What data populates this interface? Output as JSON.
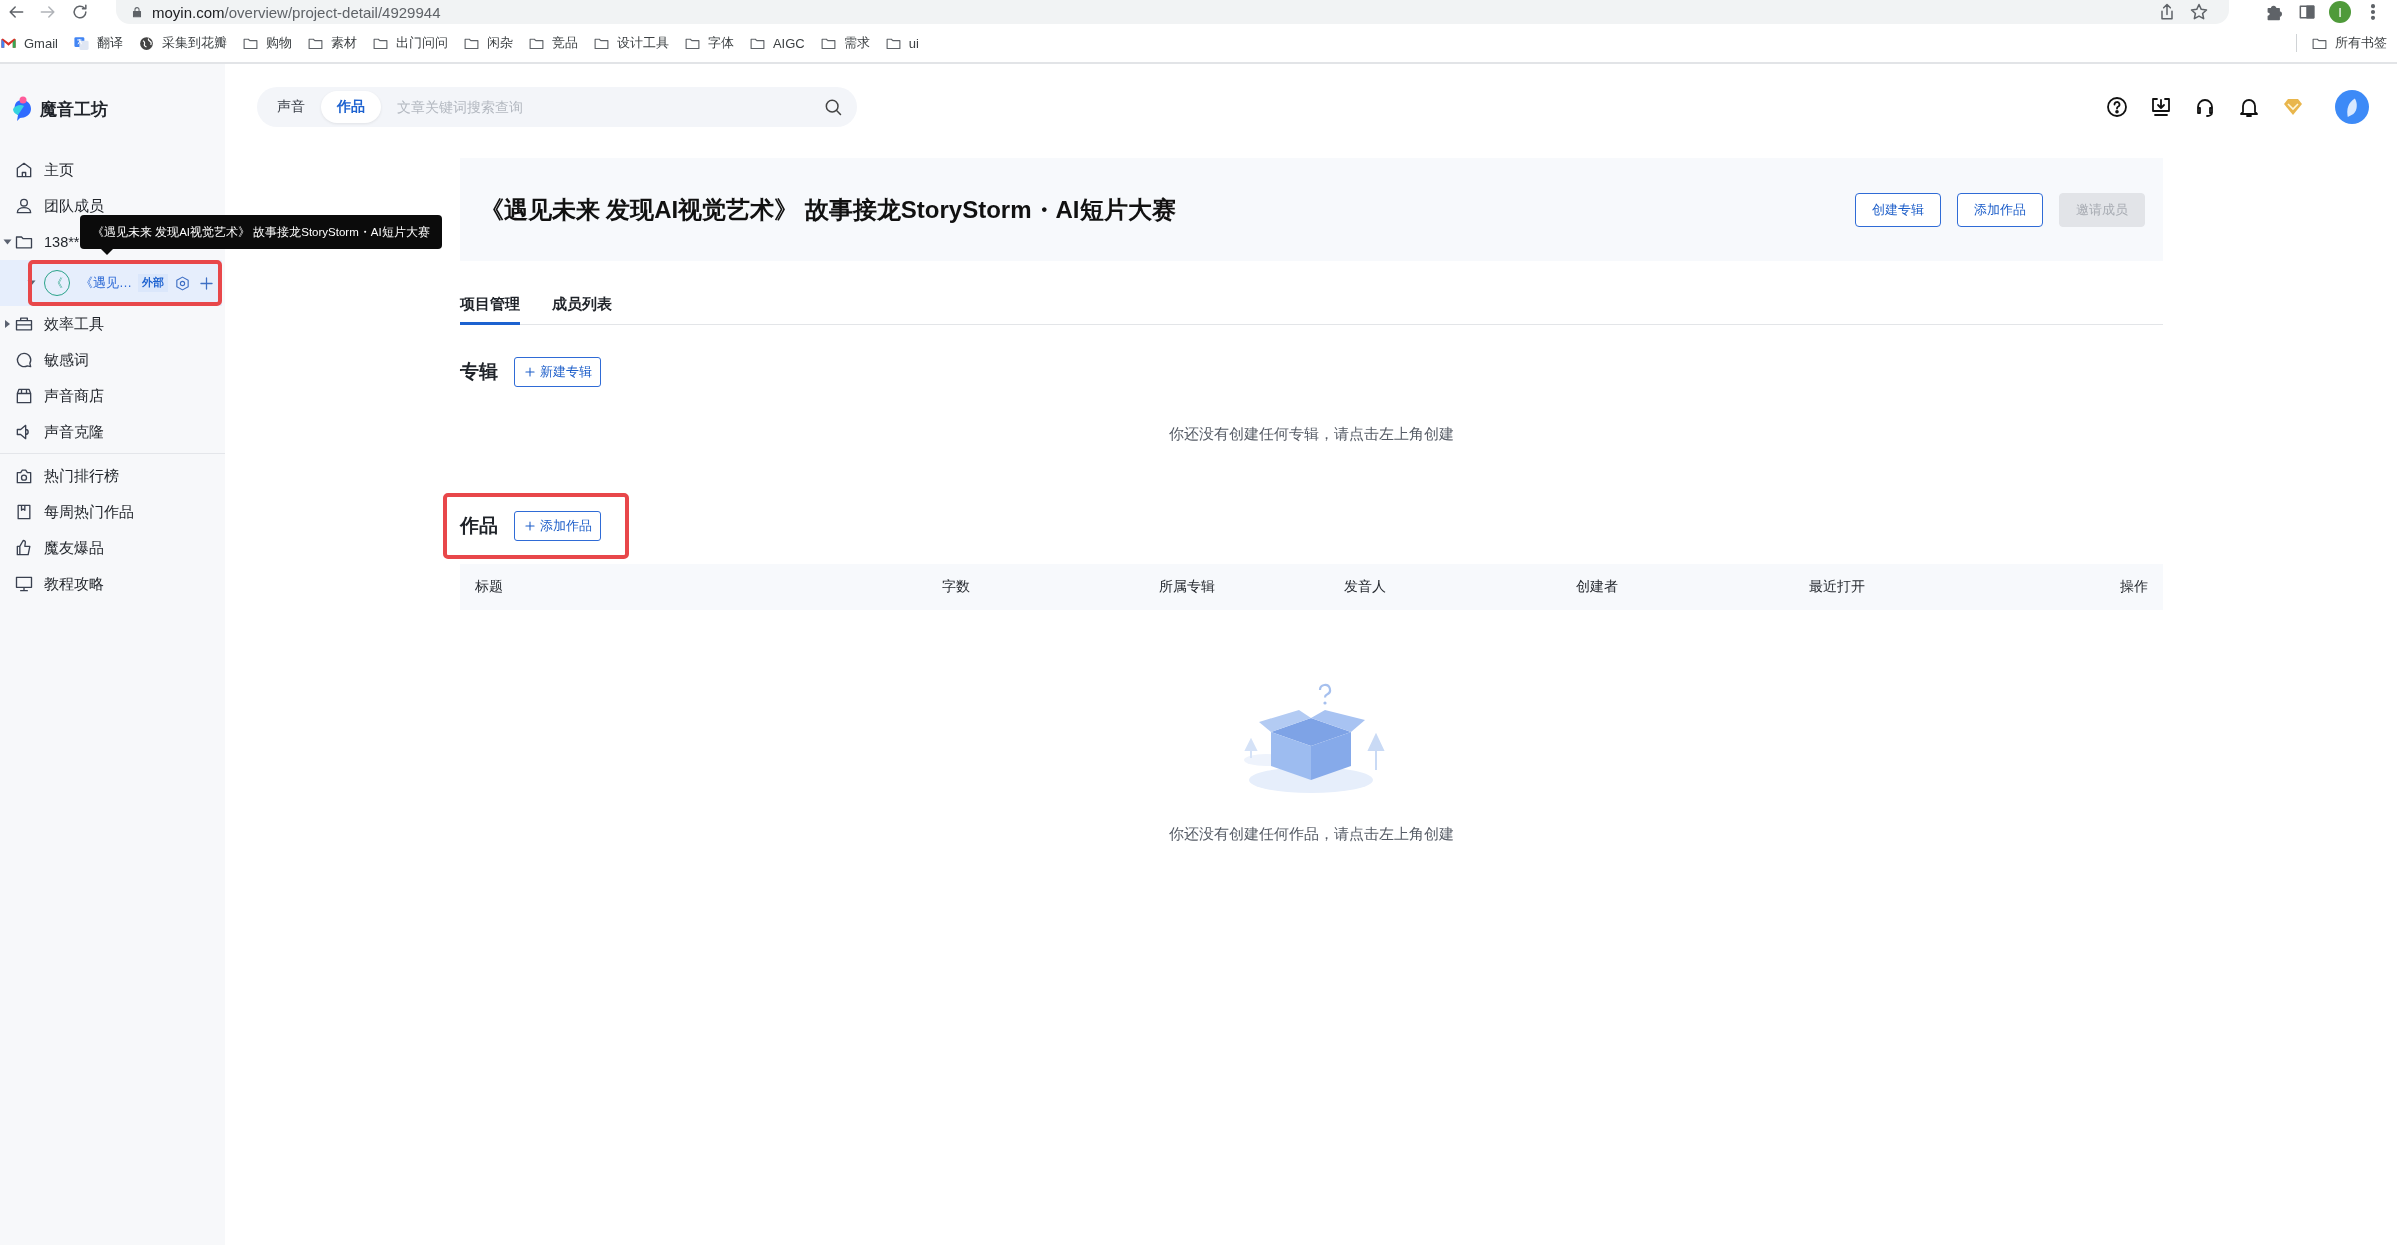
{
  "browser": {
    "url_host": "moyin.com",
    "url_path": "/overview/project-detail/4929944",
    "profile_initial": "I",
    "bookmarks": [
      {
        "label": "Gmail",
        "kind": "gmail"
      },
      {
        "label": "翻译",
        "kind": "translate"
      },
      {
        "label": "采集到花瓣",
        "kind": "globe"
      },
      {
        "label": "购物",
        "kind": "folder"
      },
      {
        "label": "素材",
        "kind": "folder"
      },
      {
        "label": "出门问问",
        "kind": "folder"
      },
      {
        "label": "闲杂",
        "kind": "folder"
      },
      {
        "label": "竞品",
        "kind": "folder"
      },
      {
        "label": "设计工具",
        "kind": "folder"
      },
      {
        "label": "字体",
        "kind": "folder"
      },
      {
        "label": "AIGC",
        "kind": "folder"
      },
      {
        "label": "需求",
        "kind": "folder"
      },
      {
        "label": "ui",
        "kind": "folder"
      }
    ],
    "all_bookmarks": "所有书签"
  },
  "app": {
    "name": "魔音工坊"
  },
  "sidebar": {
    "groups": [
      [
        {
          "label": "主页",
          "kind": "link"
        },
        {
          "label": "团队成员",
          "kind": "link"
        },
        {
          "label": "138**",
          "kind": "group",
          "expanded": true,
          "tooltip": "《遇见未来 发现AI视觉艺术》 故事接龙StoryStorm・AI短片大赛",
          "children": [
            {
              "label": "《遇见…",
              "avatar_text": "《",
              "tag": "外部",
              "selected": true,
              "highlighted": true,
              "expanded": true
            }
          ]
        },
        {
          "label": "效率工具",
          "kind": "group",
          "expanded": false
        },
        {
          "label": "敏感词",
          "kind": "link"
        },
        {
          "label": "声音商店",
          "kind": "link"
        },
        {
          "label": "声音克隆",
          "kind": "link"
        }
      ],
      [
        {
          "label": "热门排行榜",
          "kind": "link"
        },
        {
          "label": "每周热门作品",
          "kind": "link"
        },
        {
          "label": "魔友爆品",
          "kind": "link"
        },
        {
          "label": "教程攻略",
          "kind": "link"
        }
      ]
    ]
  },
  "header": {
    "search": {
      "tabs": [
        {
          "label": "声音",
          "selected": false
        },
        {
          "label": "作品",
          "selected": true
        }
      ],
      "placeholder": "文章关键词搜索查询"
    }
  },
  "project": {
    "title": "《遇见未来 发现AI视觉艺术》 故事接龙StoryStorm・AI短片大赛",
    "buttons": [
      {
        "label": "创建专辑",
        "disabled": false
      },
      {
        "label": "添加作品",
        "disabled": false
      },
      {
        "label": "邀请成员",
        "disabled": true
      }
    ],
    "tabs": [
      {
        "label": "项目管理",
        "selected": true
      },
      {
        "label": "成员列表",
        "selected": false
      }
    ]
  },
  "albums": {
    "heading": "专辑",
    "add_button": "新建专辑",
    "empty_text": "你还没有创建任何专辑，请点击左上角创建"
  },
  "works": {
    "heading": "作品",
    "add_button": "添加作品",
    "highlighted": true,
    "table": {
      "columns": [
        "标题",
        "字数",
        "所属专辑",
        "发音人",
        "创建者",
        "最近打开",
        "操作"
      ]
    },
    "empty_text": "你还没有创建任何作品，请点击左上角创建"
  }
}
